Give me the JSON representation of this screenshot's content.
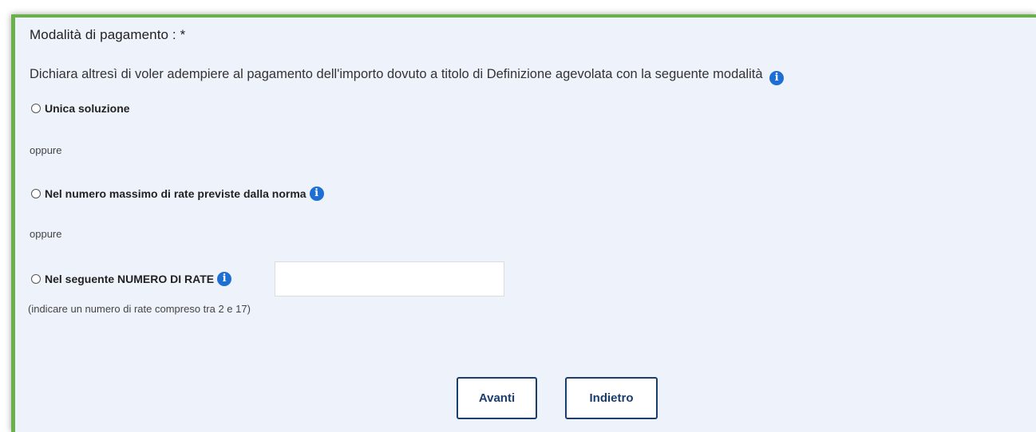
{
  "section": {
    "title": "Modalità di pagamento : *",
    "declaration": "Dichiara altresì di voler adempiere al pagamento dell'importo dovuto a titolo di Definizione agevolata con la seguente modalità"
  },
  "options": [
    {
      "label": "Unica soluzione",
      "selected": false,
      "has_info": false
    },
    {
      "label": "Nel numero massimo di rate previste dalla norma",
      "selected": false,
      "has_info": true
    },
    {
      "label": "Nel seguente NUMERO DI RATE",
      "selected": false,
      "has_info": true
    }
  ],
  "separator": "oppure",
  "rate_input": {
    "value": "",
    "hint": "(indicare un numero di rate compreso tra 2 e 17)"
  },
  "buttons": {
    "next": "Avanti",
    "back": "Indietro"
  },
  "icons": {
    "info": "info-icon",
    "info_glyph": "i"
  },
  "colors": {
    "panel_border": "#6ab04c",
    "panel_bg": "#eef3fb",
    "info_icon": "#1e6fd4",
    "button_border": "#1b3d6b"
  }
}
